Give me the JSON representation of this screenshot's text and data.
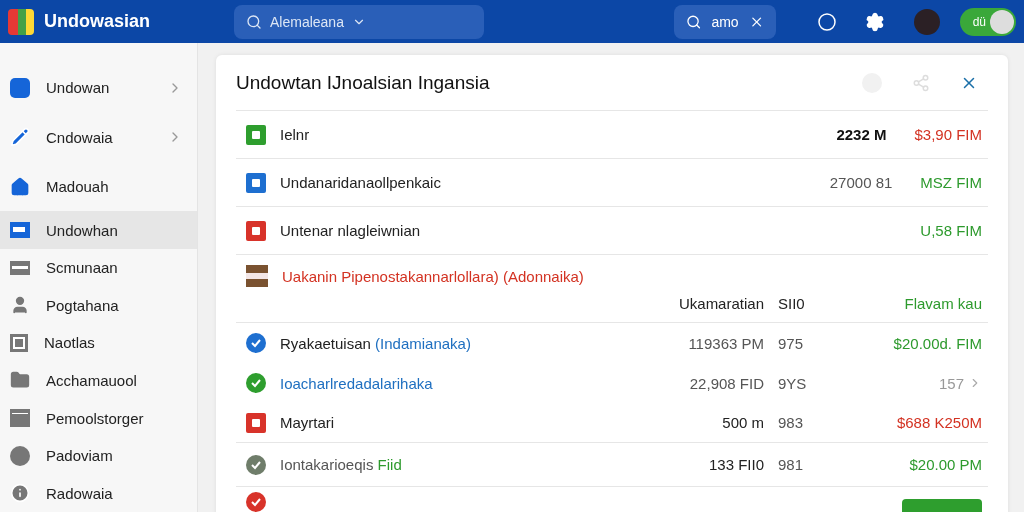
{
  "app": {
    "title": "Undowasian"
  },
  "search": {
    "value": "Alemaleana"
  },
  "quick_search": {
    "value": "amo"
  },
  "toggle": {
    "label": "dü",
    "on": true
  },
  "sidebar": {
    "items": [
      {
        "label": "Undowan",
        "active_icon": true,
        "expandable": true,
        "selected": false
      },
      {
        "label": "Cndowaia",
        "active_icon": true,
        "expandable": true,
        "selected": false
      },
      {
        "label": "Madouah",
        "active_icon": true,
        "expandable": false,
        "selected": false
      },
      {
        "label": "Undowhan",
        "active_icon": true,
        "expandable": false,
        "selected": true
      },
      {
        "label": "Scmunaan",
        "active_icon": false,
        "expandable": false,
        "selected": false
      },
      {
        "label": "Pogtahana",
        "active_icon": false,
        "expandable": false,
        "selected": false
      },
      {
        "label": "Naotlas",
        "active_icon": false,
        "expandable": false,
        "selected": false
      },
      {
        "label": "Acchamauool",
        "active_icon": false,
        "expandable": false,
        "selected": false
      },
      {
        "label": "Pemoolstorger",
        "active_icon": false,
        "expandable": false,
        "selected": false
      },
      {
        "label": "Padoviam",
        "active_icon": false,
        "expandable": false,
        "selected": false
      },
      {
        "label": "Radowaia",
        "active_icon": false,
        "expandable": false,
        "selected": false
      }
    ]
  },
  "panel": {
    "title": "Undowtan IJnoalsian Ingansia",
    "rows": [
      {
        "kind": "item",
        "color": "#2e9e2e",
        "label": {
          "text": "Ielnr",
          "color": "#222222"
        },
        "values": [
          {
            "text": "2232 M",
            "color": "#111111"
          },
          {
            "text": "$3,90 FIM",
            "color": "#d33222"
          }
        ],
        "divider": true
      },
      {
        "kind": "item",
        "color": "#1e6fd0",
        "label": {
          "text": "Undanaridanaollpenkaic",
          "color": "#222222"
        },
        "values": [
          {
            "text": "27000 81",
            "color": "#555555"
          },
          {
            "text": "MSZ FIM",
            "color": "#2d9a2d"
          }
        ],
        "divider": true
      },
      {
        "kind": "item",
        "color": "#d8332a",
        "label": {
          "text": "Untenar nlagleiwnian",
          "color": "#222222"
        },
        "values": [
          {
            "text": "U,58 FIM",
            "color": "#2d9a2d"
          }
        ],
        "divider": true
      },
      {
        "kind": "group",
        "color": "#7a5230",
        "label": {
          "text": "Uakanin Pipenostakannarlollara) (Adonnaika)",
          "color": "#d33222"
        },
        "columns": [
          {
            "text": "Ukamaratian",
            "color": "#222222"
          },
          {
            "text": "SII0",
            "color": "#222222"
          },
          {
            "text": "Flavam kau",
            "color": "#2d9a2d"
          }
        ],
        "divider": true
      },
      {
        "kind": "entry",
        "color": "#1e6fd0",
        "label": {
          "text": "Ryakaetuisan",
          "color": "#222222"
        },
        "note": {
          "text": "(Indamianaka)",
          "color": "#1e6fc0"
        },
        "columns": [
          {
            "text": "119363 PM",
            "color": "#555555"
          },
          {
            "text": "975",
            "color": "#555555"
          },
          {
            "text": "$20.00d. FIM",
            "color": "#2d9a2d"
          }
        ],
        "divider": false
      },
      {
        "kind": "entry",
        "color": "#2e9e2e",
        "label": {
          "text": "Ioacharlredadalarihaka",
          "color": "#1e6fc0"
        },
        "columns": [
          {
            "text": "22,908 FID",
            "color": "#555555"
          },
          {
            "text": "9YS",
            "color": "#555555"
          },
          {
            "text": "157",
            "color": "#999999",
            "chevron": true
          }
        ],
        "divider": false
      },
      {
        "kind": "entry",
        "color": "#d8332a",
        "label": {
          "text": "Mayrtari",
          "color": "#222222"
        },
        "columns": [
          {
            "text": "500 m",
            "color": "#222222"
          },
          {
            "text": "983",
            "color": "#555555"
          },
          {
            "text": "$688 K250M",
            "color": "#d33222"
          }
        ],
        "divider": true
      },
      {
        "kind": "entry",
        "color": "#6f7d6a",
        "label": {
          "text": "Iontakarioeqis",
          "color": "#555555"
        },
        "note": {
          "text": "Fiid",
          "color": "#2d9a2d"
        },
        "columns": [
          {
            "text": "133 FII0",
            "color": "#222222"
          },
          {
            "text": "981",
            "color": "#555555"
          },
          {
            "text": "$20.00 PM",
            "color": "#2d9a2d"
          }
        ],
        "divider": true
      },
      {
        "kind": "partial",
        "color": "#d8332a",
        "badge": {
          "color": "#2e9e2e"
        },
        "divider": false
      }
    ]
  }
}
